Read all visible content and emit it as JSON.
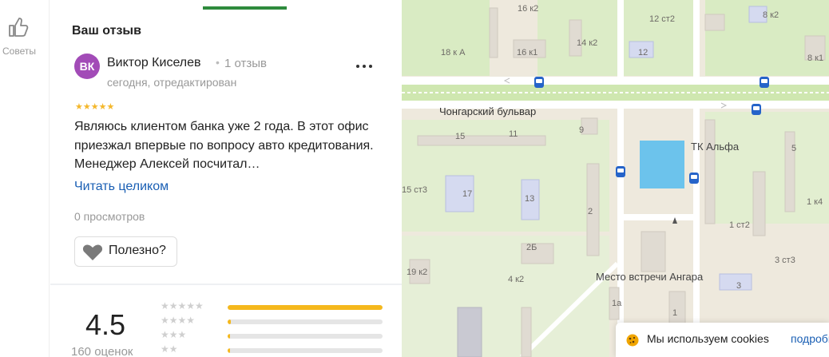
{
  "rail": {
    "tips_label": "Советы"
  },
  "review": {
    "section_title": "Ваш отзыв",
    "avatar_initials": "ВК",
    "author": "Виктор Киселев",
    "author_reviews": "1 отзыв",
    "date": "сегодня, отредактирован",
    "stars": "★★★★★",
    "rating_given": 5,
    "text": "Являюсь клиентом банка уже 2 года. В этот офис приезжал впервые по вопросу авто кредитования. Менеджер Алексей посчитал…",
    "read_more": "Читать целиком",
    "views": "0 просмотров",
    "useful_label": "Полезно?"
  },
  "summary": {
    "rating": "4.5",
    "count": "160 оценок",
    "distribution": [
      {
        "stars": "★★★★★",
        "fraction": 1.0
      },
      {
        "stars": "★★★★",
        "fraction": 0.02
      },
      {
        "stars": "★★★",
        "fraction": 0.015
      },
      {
        "stars": "★★",
        "fraction": 0.015
      }
    ]
  },
  "map": {
    "street": "Чонгарский бульвар",
    "poi_tk": "ТК Альфа",
    "poi_meeting": "Место встречи Ангара",
    "building_labels": [
      "16 к2",
      "12 ст2",
      "8 к2",
      "14 к2",
      "18 к А",
      "16 к1",
      "12",
      "8 к1",
      "15",
      "11",
      "9",
      "5",
      "15 ст3",
      "17",
      "13",
      "1 к4",
      "2",
      "1 ст2",
      "2Б",
      "19 к2",
      "4 к2",
      "3 ст3",
      "3",
      "1а",
      "1"
    ]
  },
  "cookie": {
    "text": "Мы используем cookies",
    "link": "подробнее"
  },
  "colors": {
    "accent_green": "#2e8b3d",
    "star": "#f4b72b",
    "link": "#1a5fb4",
    "avatar": "#a24bb7",
    "bus": "#2563c9"
  }
}
